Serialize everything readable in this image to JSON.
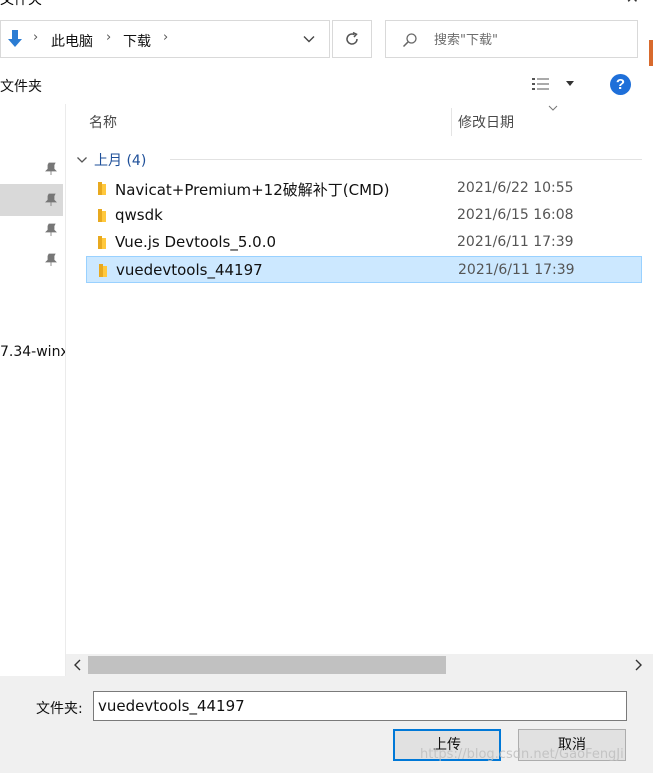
{
  "window": {
    "title": "文件夹"
  },
  "address_bar": {
    "crumbs": [
      "此电脑",
      "下载"
    ]
  },
  "search": {
    "placeholder": "搜索\"下载\""
  },
  "toolbar": {
    "new_folder_label": "文件夹",
    "help_label": "?"
  },
  "nav_pane": {
    "truncated_item": "7.34-winx"
  },
  "columns": {
    "name": "名称",
    "date_modified": "修改日期"
  },
  "group": {
    "label": "上月 (4)"
  },
  "files": [
    {
      "name": "Navicat+Premium+12破解补丁(CMD)",
      "date": "2021/6/22 10:55",
      "selected": false
    },
    {
      "name": "qwsdk",
      "date": "2021/6/15 16:08",
      "selected": false
    },
    {
      "name": "Vue.js Devtools_5.0.0",
      "date": "2021/6/11 17:39",
      "selected": false
    },
    {
      "name": "vuedevtools_44197",
      "date": "2021/6/11 17:39",
      "selected": true
    }
  ],
  "bottom": {
    "folder_label": "文件夹:",
    "folder_value": "vuedevtools_44197",
    "upload_label": "上传",
    "cancel_label": "取消"
  },
  "watermark": "https://blog.csdn.net/GaoFengJi",
  "colors": {
    "accent": "#0078d7",
    "selection": "#cce8ff",
    "folder": "#ffc83d",
    "group_label": "#1e4f99",
    "help": "#1e6fd9"
  }
}
